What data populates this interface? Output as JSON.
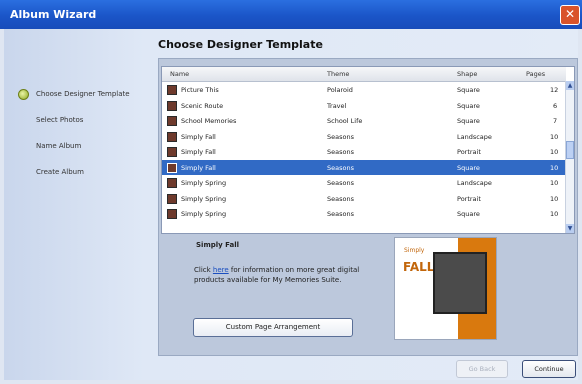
{
  "window": {
    "title": "Album Wizard",
    "close_glyph": "✕"
  },
  "heading": "Choose Designer Template",
  "steps": [
    {
      "label": "Choose Designer Template",
      "active": true
    },
    {
      "label": "Select Photos",
      "active": false
    },
    {
      "label": "Name Album",
      "active": false
    },
    {
      "label": "Create Album",
      "active": false
    }
  ],
  "table": {
    "headers": [
      "Name",
      "Theme",
      "Shape",
      "Pages"
    ],
    "rows": [
      {
        "name": "Picture This",
        "theme": "Polaroid",
        "shape": "Square",
        "pages": "12"
      },
      {
        "name": "Scenic Route",
        "theme": "Travel",
        "shape": "Square",
        "pages": "6"
      },
      {
        "name": "School Memories",
        "theme": "School Life",
        "shape": "Square",
        "pages": "7"
      },
      {
        "name": "Simply Fall",
        "theme": "Seasons",
        "shape": "Landscape",
        "pages": "10"
      },
      {
        "name": "Simply Fall",
        "theme": "Seasons",
        "shape": "Portrait",
        "pages": "10"
      },
      {
        "name": "Simply Fall",
        "theme": "Seasons",
        "shape": "Square",
        "pages": "10",
        "selected": true
      },
      {
        "name": "Simply Spring",
        "theme": "Seasons",
        "shape": "Landscape",
        "pages": "10"
      },
      {
        "name": "Simply Spring",
        "theme": "Seasons",
        "shape": "Portrait",
        "pages": "10"
      },
      {
        "name": "Simply Spring",
        "theme": "Seasons",
        "shape": "Square",
        "pages": "10"
      }
    ]
  },
  "detail": {
    "title": "Simply Fall",
    "desc_before": "Click ",
    "link_text": "here",
    "desc_after": " for information on more great digital products available for My Memories Suite.",
    "custom_button": "Custom Page Arrangement",
    "preview_title": "Simply",
    "preview_big": "FALL"
  },
  "buttons": {
    "go_back": "Go Back",
    "continue": "Continue"
  },
  "colors": {
    "selection": "#316ac5",
    "titlebar": "#1b55c8",
    "accent_orange": "#d9790e"
  }
}
